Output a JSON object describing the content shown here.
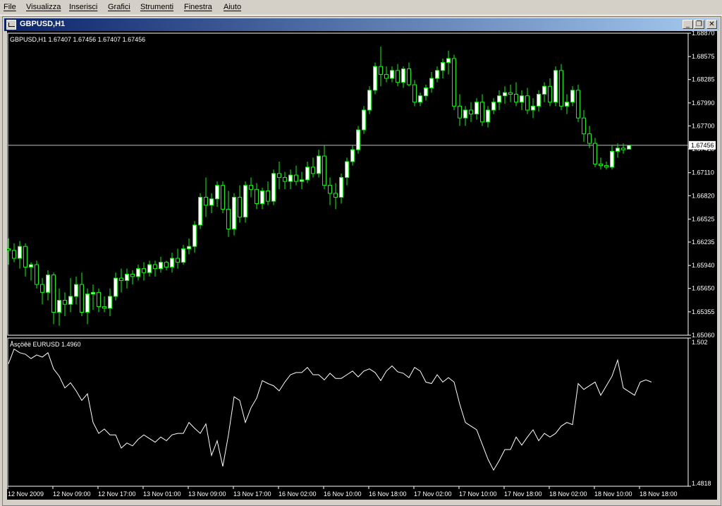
{
  "menu": [
    {
      "label": "File"
    },
    {
      "label": "Visualizza"
    },
    {
      "label": "Inserisci"
    },
    {
      "label": "Grafici"
    },
    {
      "label": "Strumenti"
    },
    {
      "label": "Finestra"
    },
    {
      "label": "Aiuto"
    }
  ],
  "window": {
    "title": "GBPUSD,H1",
    "minimize_glyph": "_",
    "restore_glyph": "❐",
    "close_glyph": "✕"
  },
  "colors": {
    "background": "#000000",
    "candle": "#00ff00",
    "candle_bull_body": "#ffffff",
    "candle_bear_body": "#000000",
    "price_line": "#c0c0c0",
    "indicator_line": "#ffffff",
    "axis_text": "#ffffff"
  },
  "chart_data": [
    {
      "type": "candlestick",
      "info_label": "GBPUSD,H1  1.67407 1.67456 1.67407 1.67456",
      "symbol": "GBPUSD,H1",
      "ohlc_text": "1.67407 1.67456 1.67407 1.67456",
      "current_price": 1.67456,
      "current_price_label": "1.67456",
      "ylim": [
        1.6506,
        1.6887
      ],
      "y_ticks": [
        "1.68870",
        "1.68575",
        "1.68285",
        "1.67990",
        "1.67700",
        "1.67410",
        "1.67110",
        "1.66820",
        "1.66525",
        "1.66235",
        "1.65940",
        "1.65650",
        "1.65355",
        "1.65060"
      ],
      "y_tick_values": [
        1.6887,
        1.68575,
        1.68285,
        1.6799,
        1.677,
        1.6741,
        1.6711,
        1.6682,
        1.66525,
        1.66235,
        1.6594,
        1.6565,
        1.65355,
        1.6506
      ],
      "x_ticks": [
        "12 Nov 2009",
        "12 Nov 09:00",
        "12 Nov 17:00",
        "13 Nov 01:00",
        "13 Nov 09:00",
        "13 Nov 17:00",
        "16 Nov 02:00",
        "16 Nov 10:00",
        "16 Nov 18:00",
        "17 Nov 02:00",
        "17 Nov 10:00",
        "17 Nov 18:00",
        "18 Nov 02:00",
        "18 Nov 10:00",
        "18 Nov 18:00"
      ],
      "candles": [
        [
          1.6615,
          1.6628,
          1.6595,
          1.6613
        ],
        [
          1.6613,
          1.6622,
          1.6598,
          1.6603
        ],
        [
          1.6603,
          1.6625,
          1.659,
          1.6618
        ],
        [
          1.6618,
          1.6622,
          1.658,
          1.6592
        ],
        [
          1.6592,
          1.6598,
          1.6575,
          1.6595
        ],
        [
          1.6595,
          1.66,
          1.6565,
          1.657
        ],
        [
          1.657,
          1.6578,
          1.6545,
          1.656
        ],
        [
          1.656,
          1.6588,
          1.655,
          1.6582
        ],
        [
          1.6582,
          1.6585,
          1.652,
          1.6535
        ],
        [
          1.6535,
          1.6565,
          1.6518,
          1.655
        ],
        [
          1.655,
          1.656,
          1.653,
          1.6545
        ],
        [
          1.6545,
          1.6578,
          1.6535,
          1.6555
        ],
        [
          1.6555,
          1.658,
          1.6545,
          1.657
        ],
        [
          1.657,
          1.6585,
          1.653,
          1.6535
        ],
        [
          1.6535,
          1.6565,
          1.652,
          1.6558
        ],
        [
          1.6558,
          1.657,
          1.6538,
          1.656
        ],
        [
          1.656,
          1.6565,
          1.6535,
          1.6542
        ],
        [
          1.6542,
          1.6555,
          1.6535,
          1.654
        ],
        [
          1.654,
          1.6565,
          1.653,
          1.6555
        ],
        [
          1.6555,
          1.6585,
          1.655,
          1.6578
        ],
        [
          1.6578,
          1.659,
          1.656,
          1.6575
        ],
        [
          1.6575,
          1.659,
          1.6565,
          1.6583
        ],
        [
          1.6583,
          1.6588,
          1.657,
          1.658
        ],
        [
          1.658,
          1.6595,
          1.6575,
          1.659
        ],
        [
          1.659,
          1.6598,
          1.6575,
          1.6585
        ],
        [
          1.6585,
          1.66,
          1.658,
          1.6595
        ],
        [
          1.6595,
          1.66,
          1.658,
          1.659
        ],
        [
          1.659,
          1.6605,
          1.6585,
          1.6598
        ],
        [
          1.6598,
          1.66,
          1.6588,
          1.6592
        ],
        [
          1.6592,
          1.661,
          1.6585,
          1.6603
        ],
        [
          1.6603,
          1.6615,
          1.659,
          1.6598
        ],
        [
          1.6598,
          1.662,
          1.6595,
          1.6615
        ],
        [
          1.6615,
          1.6628,
          1.6608,
          1.6618
        ],
        [
          1.6618,
          1.665,
          1.661,
          1.6645
        ],
        [
          1.6645,
          1.6685,
          1.664,
          1.668
        ],
        [
          1.668,
          1.6705,
          1.6655,
          1.667
        ],
        [
          1.667,
          1.6685,
          1.666,
          1.6678
        ],
        [
          1.6678,
          1.67,
          1.6668,
          1.6695
        ],
        [
          1.6695,
          1.67,
          1.666,
          1.6665
        ],
        [
          1.6665,
          1.6688,
          1.663,
          1.664
        ],
        [
          1.664,
          1.6685,
          1.6632,
          1.668
        ],
        [
          1.668,
          1.6695,
          1.6648,
          1.6655
        ],
        [
          1.6655,
          1.67,
          1.6648,
          1.6695
        ],
        [
          1.6695,
          1.6705,
          1.668,
          1.669
        ],
        [
          1.669,
          1.6698,
          1.6665,
          1.6672
        ],
        [
          1.6672,
          1.6692,
          1.6665,
          1.6688
        ],
        [
          1.6688,
          1.67,
          1.667,
          1.6675
        ],
        [
          1.6675,
          1.6715,
          1.667,
          1.671
        ],
        [
          1.671,
          1.6725,
          1.669,
          1.6705
        ],
        [
          1.6705,
          1.6712,
          1.669,
          1.67
        ],
        [
          1.67,
          1.6715,
          1.669,
          1.6708
        ],
        [
          1.6708,
          1.672,
          1.6695,
          1.67
        ],
        [
          1.67,
          1.6712,
          1.669,
          1.6702
        ],
        [
          1.6702,
          1.6725,
          1.6698,
          1.6718
        ],
        [
          1.6718,
          1.673,
          1.6705,
          1.671
        ],
        [
          1.671,
          1.674,
          1.6705,
          1.6732
        ],
        [
          1.6732,
          1.6745,
          1.669,
          1.6695
        ],
        [
          1.6695,
          1.6705,
          1.667,
          1.6685
        ],
        [
          1.6685,
          1.6698,
          1.6665,
          1.668
        ],
        [
          1.668,
          1.671,
          1.6672,
          1.6705
        ],
        [
          1.6705,
          1.673,
          1.6695,
          1.6725
        ],
        [
          1.6725,
          1.6745,
          1.672,
          1.674
        ],
        [
          1.674,
          1.677,
          1.6735,
          1.6765
        ],
        [
          1.6765,
          1.6795,
          1.676,
          1.679
        ],
        [
          1.679,
          1.682,
          1.6785,
          1.6815
        ],
        [
          1.6815,
          1.685,
          1.681,
          1.6845
        ],
        [
          1.6845,
          1.687,
          1.682,
          1.6835
        ],
        [
          1.6835,
          1.6845,
          1.6825,
          1.683
        ],
        [
          1.683,
          1.6845,
          1.6825,
          1.684
        ],
        [
          1.684,
          1.6848,
          1.682,
          1.6825
        ],
        [
          1.6825,
          1.6845,
          1.6818,
          1.6842
        ],
        [
          1.6842,
          1.685,
          1.682,
          1.6822
        ],
        [
          1.6822,
          1.6828,
          1.6795,
          1.68
        ],
        [
          1.68,
          1.6812,
          1.6795,
          1.6808
        ],
        [
          1.6808,
          1.6822,
          1.6802,
          1.6818
        ],
        [
          1.6818,
          1.6838,
          1.6812,
          1.683
        ],
        [
          1.683,
          1.6845,
          1.6825,
          1.684
        ],
        [
          1.684,
          1.6855,
          1.683,
          1.685
        ],
        [
          1.685,
          1.6865,
          1.6835,
          1.6855
        ],
        [
          1.6855,
          1.686,
          1.679,
          1.6795
        ],
        [
          1.6795,
          1.681,
          1.677,
          1.678
        ],
        [
          1.678,
          1.6795,
          1.677,
          1.679
        ],
        [
          1.679,
          1.68,
          1.6775,
          1.6785
        ],
        [
          1.6785,
          1.6805,
          1.6778,
          1.68
        ],
        [
          1.68,
          1.681,
          1.677,
          1.6775
        ],
        [
          1.6775,
          1.6795,
          1.6768,
          1.679
        ],
        [
          1.679,
          1.6805,
          1.6785,
          1.68
        ],
        [
          1.68,
          1.6815,
          1.679,
          1.6808
        ],
        [
          1.6808,
          1.682,
          1.6798,
          1.6812
        ],
        [
          1.6812,
          1.6822,
          1.68,
          1.681
        ],
        [
          1.681,
          1.6825,
          1.6795,
          1.68
        ],
        [
          1.68,
          1.6815,
          1.679,
          1.6808
        ],
        [
          1.6808,
          1.6818,
          1.6785,
          1.679
        ],
        [
          1.679,
          1.6805,
          1.678,
          1.6795
        ],
        [
          1.6795,
          1.6815,
          1.6788,
          1.681
        ],
        [
          1.681,
          1.6825,
          1.68,
          1.682
        ],
        [
          1.682,
          1.683,
          1.6795,
          1.68
        ],
        [
          1.68,
          1.6845,
          1.6795,
          1.684
        ],
        [
          1.684,
          1.6848,
          1.679,
          1.6795
        ],
        [
          1.6795,
          1.681,
          1.6785,
          1.68
        ],
        [
          1.68,
          1.682,
          1.6795,
          1.6815
        ],
        [
          1.6815,
          1.6822,
          1.6775,
          1.678
        ],
        [
          1.678,
          1.679,
          1.675,
          1.676
        ],
        [
          1.676,
          1.677,
          1.6742,
          1.6748
        ],
        [
          1.6748,
          1.6755,
          1.6718,
          1.6722
        ],
        [
          1.6722,
          1.673,
          1.6715,
          1.672
        ],
        [
          1.672,
          1.6725,
          1.6715,
          1.6718
        ],
        [
          1.6718,
          1.6745,
          1.6715,
          1.6738
        ],
        [
          1.6738,
          1.6748,
          1.673,
          1.6742
        ],
        [
          1.6742,
          1.6748,
          1.6735,
          1.674
        ],
        [
          1.67407,
          1.67456,
          1.67407,
          1.67456
        ]
      ]
    },
    {
      "type": "line",
      "series_name": "EURUSD",
      "label": "Åsçöêë EURUSD 1.4960",
      "ylim": [
        1.4818,
        1.502
      ],
      "y_ticks": [
        "1.502",
        "1.4818"
      ],
      "y_tick_values": [
        1.502,
        1.4818
      ],
      "values": [
        1.4985,
        1.5005,
        1.5,
        1.4998,
        1.4992,
        1.4997,
        1.4994,
        1.5,
        1.4978,
        1.4968,
        1.4952,
        1.4959,
        1.4948,
        1.4935,
        1.4944,
        1.4905,
        1.489,
        1.4896,
        1.4888,
        1.4888,
        1.487,
        1.4877,
        1.4873,
        1.4882,
        1.4888,
        1.4883,
        1.4878,
        1.4885,
        1.488,
        1.4888,
        1.489,
        1.489,
        1.4905,
        1.4897,
        1.489,
        1.4903,
        1.486,
        1.488,
        1.4845,
        1.4888,
        1.494,
        1.4935,
        1.4905,
        1.4925,
        1.4938,
        1.4962,
        1.4958,
        1.4955,
        1.4948,
        1.496,
        1.497,
        1.4973,
        1.4973,
        1.498,
        1.497,
        1.497,
        1.4963,
        1.4972,
        1.4965,
        1.4965,
        1.497,
        1.4975,
        1.4967,
        1.4975,
        1.4978,
        1.4973,
        1.4962,
        1.4975,
        1.4982,
        1.4974,
        1.4972,
        1.4966,
        1.498,
        1.4975,
        1.496,
        1.4958,
        1.497,
        1.496,
        1.4966,
        1.496,
        1.493,
        1.4905,
        1.49,
        1.4895,
        1.4875,
        1.4855,
        1.484,
        1.4853,
        1.4868,
        1.4868,
        1.4885,
        1.4874,
        1.4885,
        1.4895,
        1.488,
        1.489,
        1.4885,
        1.489,
        1.49,
        1.4905,
        1.4902,
        1.4958,
        1.495,
        1.4955,
        1.496,
        1.4942,
        1.4955,
        1.4968,
        1.499,
        1.4952,
        1.4947,
        1.4942,
        1.496,
        1.4963,
        1.496
      ]
    }
  ]
}
